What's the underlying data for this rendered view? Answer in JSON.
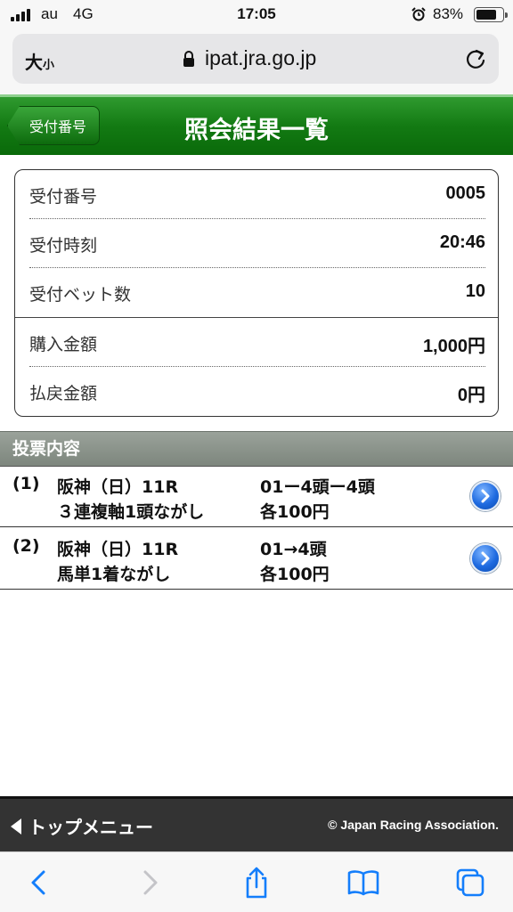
{
  "status_bar": {
    "carrier": "au",
    "network": "4G",
    "time": "17:05",
    "battery": "83%",
    "battery_level": 0.83
  },
  "browser": {
    "text_size_large": "大",
    "text_size_small": "小",
    "url": "ipat.jra.go.jp"
  },
  "header": {
    "back_label": "受付番号",
    "title": "照会結果一覧"
  },
  "summary": [
    {
      "label": "受付番号",
      "value": "0005"
    },
    {
      "label": "受付時刻",
      "value": "20:46"
    },
    {
      "label": "受付ベット数",
      "value": "10"
    },
    {
      "label": "購入金額",
      "value": "1,000円"
    },
    {
      "label": "払戻金額",
      "value": "0円"
    }
  ],
  "section_title": "投票内容",
  "bets": [
    {
      "num": "(1)",
      "race": "阪神（日）11R",
      "type": "３連複軸1頭ながし",
      "combo": "01ー4頭ー4頭",
      "amount": "各100円"
    },
    {
      "num": "(2)",
      "race": "阪神（日）11R",
      "type": "馬単1着ながし",
      "combo": "01→4頭",
      "amount": "各100円"
    }
  ],
  "footer": {
    "top_menu": "トップメニュー",
    "copyright": "© Japan Racing Association."
  },
  "icons": {
    "signal": "signal-icon",
    "alarm": "alarm-icon",
    "battery": "battery-icon",
    "lock": "lock-icon",
    "reload": "reload-icon",
    "chevron": "chevron-right-icon",
    "back": "back-arrow-icon",
    "forward": "forward-arrow-icon",
    "share": "share-icon",
    "bookmarks": "book-icon",
    "tabs": "tabs-icon"
  },
  "colors": {
    "header_green": "#137a13",
    "section_gray": "#8a928a",
    "footer_dark": "#333333",
    "link_blue": "#1e6ae0",
    "ios_blue": "#147efb"
  }
}
